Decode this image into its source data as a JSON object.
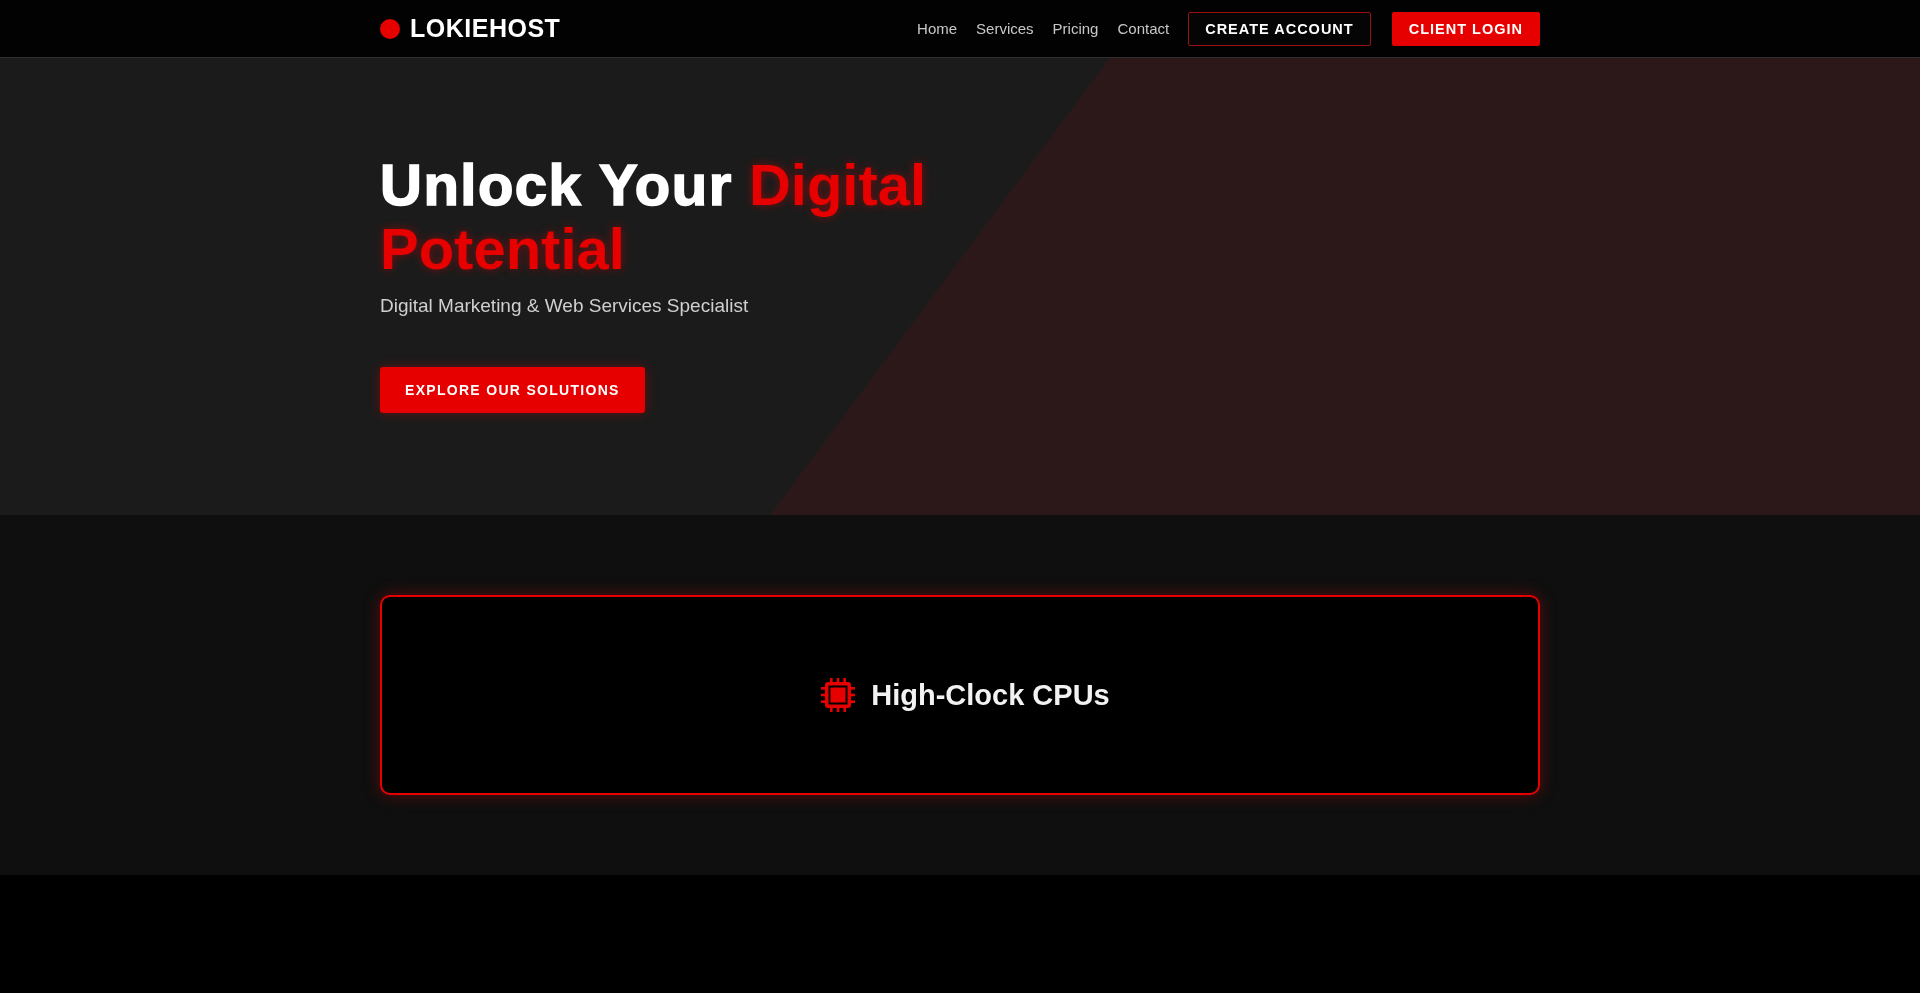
{
  "header": {
    "logo": "LOKIEHOST",
    "nav": [
      "Home",
      "Services",
      "Pricing",
      "Contact"
    ],
    "buttons": [
      {
        "label": "CREATE ACCOUNT",
        "kind": "outline"
      },
      {
        "label": "CLIENT LOGIN",
        "kind": "filled"
      }
    ]
  },
  "hero": {
    "title": "Unlock Your",
    "title_highlight": "Digital Potential",
    "subtitle": "Digital Marketing & Web Services Specialist",
    "button": "EXPLORE OUR SOLUTIONS"
  },
  "features": [
    {
      "title": "High-Clock CPUs"
    }
  ]
}
